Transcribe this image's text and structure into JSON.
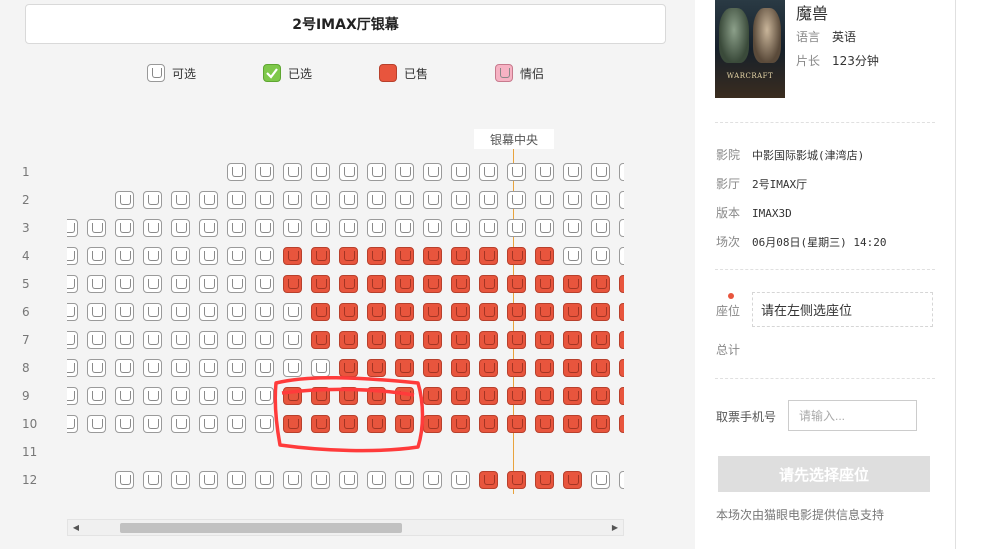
{
  "screen_title": "2号IMAX厅银幕",
  "legend": [
    {
      "label": "可选",
      "kind": "avail"
    },
    {
      "label": "已选",
      "kind": "sel"
    },
    {
      "label": "已售",
      "kind": "sold"
    },
    {
      "label": "情侣",
      "kind": "couple"
    }
  ],
  "center_label": "银幕中央",
  "rows": [
    {
      "label": "1",
      "seats": "......AAAAAAAAAAAAAAAAA"
    },
    {
      "label": "2",
      "seats": "..AAAAAAAAAAAAAAAAAAAAAA"
    },
    {
      "label": "3",
      "seats": "AAAAAAAAAAAAAAAAAAAAAAAA"
    },
    {
      "label": "4",
      "seats": "AAAAAAAASSSSSSSSSSAAAAAA"
    },
    {
      "label": "5",
      "seats": "AAAAAAAASSSSSSSSSSSSSSSS"
    },
    {
      "label": "6",
      "seats": "AAAAAAAAASSSSSSSSSSSSSSS"
    },
    {
      "label": "7",
      "seats": "AAAAAAAAASSSSSSSSSSSSSSS"
    },
    {
      "label": "8",
      "seats": "AAAAAAAAAASSSSSSSSSSSSSS"
    },
    {
      "label": "9",
      "seats": "AAAAAAAASSSSSSSSSSSSSSSS"
    },
    {
      "label": "10",
      "seats": "AAAAAAAASSSSSSSSSSSSSSSS"
    },
    {
      "label": "11",
      "seats": ""
    },
    {
      "label": "12",
      "seats": "..AAAAAAAAAAAAASSSSAAAAA"
    }
  ],
  "movie": {
    "title": "魔兽",
    "poster_text": "WARCRAFT",
    "language_label": "语言",
    "language": "英语",
    "length_label": "片长",
    "length": "123分钟"
  },
  "info": {
    "cinema_label": "影院",
    "cinema": "中影国际影城(津湾店)",
    "hall_label": "影厅",
    "hall": "2号IMAX厅",
    "version_label": "版本",
    "version": "IMAX3D",
    "session_label": "场次",
    "session": "06月08日(星期三) 14:20"
  },
  "seat_label": "座位",
  "seat_hint": "请在左侧选座位",
  "total_label": "总计",
  "phone_label": "取票手机号",
  "phone_placeholder": "请输入...",
  "submit_label": "请先选择座位",
  "footnote": "本场次由猫眼电影提供信息支持",
  "colors": {
    "sold": "#e8553d",
    "selected": "#7ec84a",
    "couple": "#f6b2c3",
    "center_line": "#e8a33d",
    "annotation": "#ff3b3b"
  }
}
